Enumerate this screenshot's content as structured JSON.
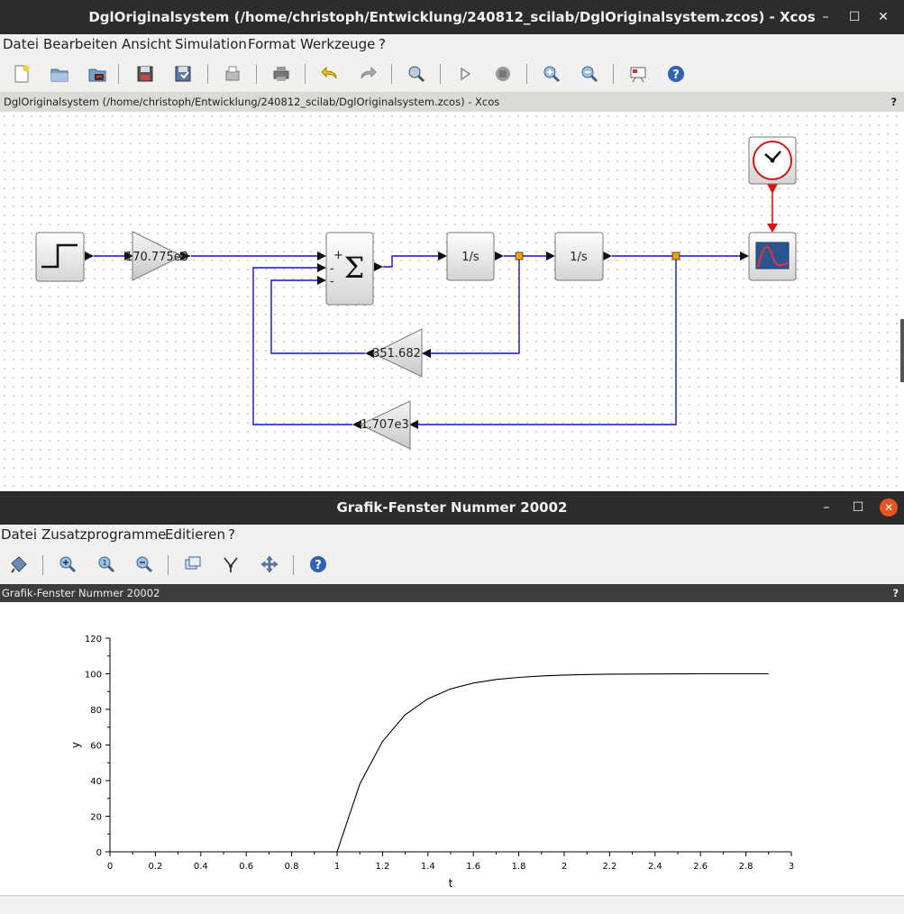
{
  "xcos": {
    "title": "DglOriginalsystem (/home/christoph/Entwicklung/240812_scilab/DglOriginalsystem.zcos) - Xcos",
    "menu": [
      "Datei",
      "Bearbeiten",
      "Ansicht",
      "Simulation",
      "Format",
      "Werkzeuge",
      "?"
    ],
    "doc_title": "DglOriginalsystem (/home/christoph/Entwicklung/240812_scilab/DglOriginalsystem.zcos) - Xcos",
    "help_mark": "?",
    "blocks": {
      "gain_in": "170.775e3",
      "integrator_1": "1/s",
      "integrator_2": "1/s",
      "gain_fb1": "351.682",
      "gain_fb2": "1.707e3",
      "sum_signs": [
        "+",
        "-",
        "-"
      ],
      "sum_symbol": "Σ"
    },
    "colors": {
      "link": "#1010c8",
      "event_link": "#e01010",
      "split": "#f4a000"
    }
  },
  "graf": {
    "title": "Grafik-Fenster Nummer 20002",
    "menu": [
      "Datei",
      "Zusatzprogramme",
      "Editieren",
      "?"
    ],
    "doc_title": "Grafik-Fenster Nummer 20002",
    "help_mark": "?"
  },
  "chart_data": {
    "type": "line",
    "title": "",
    "xlabel": "t",
    "ylabel": "y",
    "xlim": [
      0,
      3
    ],
    "ylim": [
      0,
      120
    ],
    "xticks": [
      "0",
      "0.2",
      "0.4",
      "0.6",
      "0.8",
      "1",
      "1.2",
      "1.4",
      "1.6",
      "1.8",
      "2",
      "2.2",
      "2.4",
      "2.6",
      "2.8",
      "3"
    ],
    "yticks": [
      "0",
      "20",
      "40",
      "60",
      "80",
      "100",
      "120"
    ],
    "grid": false,
    "series": [
      {
        "x": [
          0,
          1.0,
          1.1,
          1.2,
          1.3,
          1.4,
          1.5,
          1.6,
          1.7,
          1.8,
          1.9,
          2.0,
          2.1,
          2.2,
          2.4,
          2.6,
          2.9
        ],
        "y": [
          0,
          0,
          38,
          62,
          77,
          86,
          91.5,
          94.8,
          96.8,
          98.0,
          98.8,
          99.3,
          99.6,
          99.8,
          99.9,
          100,
          100
        ]
      }
    ]
  }
}
